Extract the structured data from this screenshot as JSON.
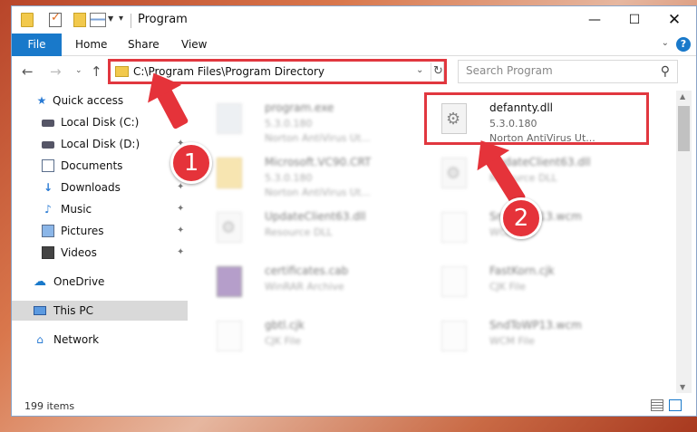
{
  "window": {
    "title": "Program"
  },
  "ribbon": {
    "tabs": [
      "File",
      "Home",
      "Share",
      "View"
    ]
  },
  "address": {
    "path": "C:\\Program Files\\Program Directory"
  },
  "search": {
    "placeholder": "Search Program"
  },
  "sidebar": {
    "items": [
      {
        "label": "Quick access",
        "icon": "star-icon"
      },
      {
        "label": "Local Disk (C:)",
        "icon": "drive-icon"
      },
      {
        "label": "Local Disk (D:)",
        "icon": "drive-icon"
      },
      {
        "label": "Documents",
        "icon": "document-icon"
      },
      {
        "label": "Downloads",
        "icon": "download-icon"
      },
      {
        "label": "Music",
        "icon": "music-icon"
      },
      {
        "label": "Pictures",
        "icon": "pictures-icon"
      },
      {
        "label": "Videos",
        "icon": "video-icon"
      },
      {
        "label": "OneDrive",
        "icon": "cloud-icon"
      },
      {
        "label": "This PC",
        "icon": "computer-icon"
      },
      {
        "label": "Network",
        "icon": "network-icon"
      }
    ]
  },
  "files": [
    {
      "name": "program.exe",
      "version": "5.3.0.180",
      "desc": "Norton AntiVirus Ut..."
    },
    {
      "name": "defannty.dll",
      "version": "5.3.0.180",
      "desc": "Norton AntiVirus Ut..."
    },
    {
      "name": "Microsoft.VC90.CRT",
      "version": "5.3.0.180",
      "desc": "Norton AntiVirus Ut..."
    },
    {
      "name": "UpdateClient63.dll",
      "version": "Resource DLL",
      "desc": ""
    },
    {
      "name": "UpdateClient63.dll",
      "version": "Resource DLL",
      "desc": ""
    },
    {
      "name": "SndToWP13.wcm",
      "version": "WCM File",
      "desc": ""
    },
    {
      "name": "certificates.cab",
      "version": "WinRAR Archive",
      "desc": ""
    },
    {
      "name": "FastKorn.cjk",
      "version": "CJK File",
      "desc": ""
    },
    {
      "name": "gbtl.cjk",
      "version": "CJK File",
      "desc": ""
    },
    {
      "name": "SndToWP13.wcm",
      "version": "WCM File",
      "desc": ""
    }
  ],
  "status": {
    "count": "199 items"
  },
  "annotations": {
    "badge1": "1",
    "badge2": "2"
  },
  "colors": {
    "accent": "#1979ca",
    "highlight": "#e1373f"
  }
}
